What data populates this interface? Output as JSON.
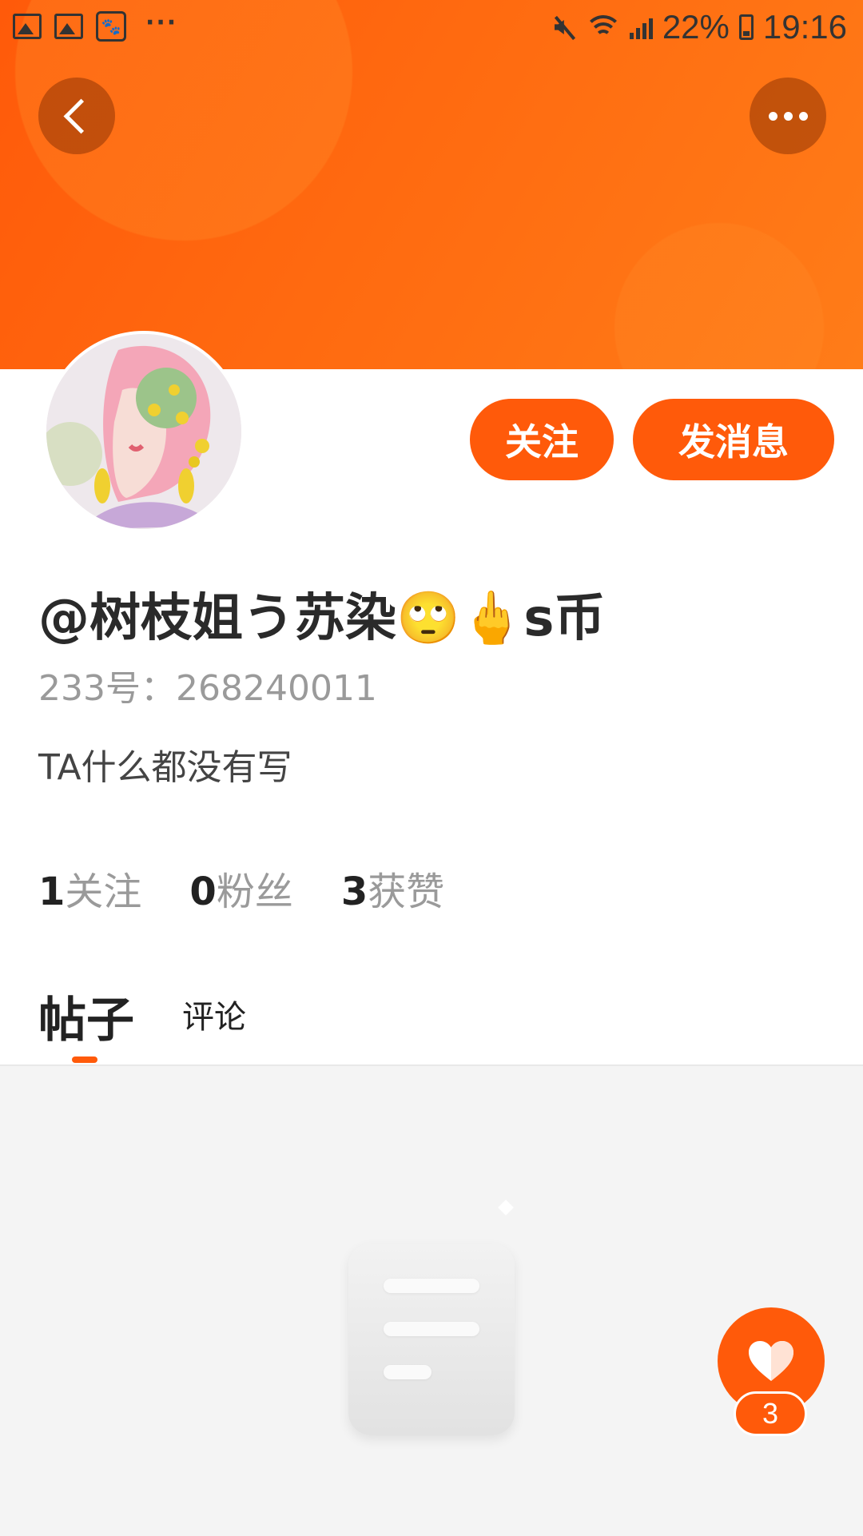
{
  "status_bar": {
    "battery": "22%",
    "time": "19:16",
    "more_glyph": "···",
    "icons": [
      "gallery-icon",
      "gallery-icon",
      "baidu-paw-icon",
      "mute-icon",
      "wifi-icon",
      "signal-icon",
      "battery-icon"
    ]
  },
  "header": {
    "back_icon": "chevron-left-icon",
    "more_icon": "more-dots-icon"
  },
  "profile": {
    "username": "@树枝姐う苏染🙄🖕s币",
    "user_id": "233号：268240011",
    "bio": "TA什么都没有写"
  },
  "actions": {
    "follow": "关注",
    "message": "发消息"
  },
  "stats": [
    {
      "value": "1",
      "label": "关注"
    },
    {
      "value": "0",
      "label": "粉丝"
    },
    {
      "value": "3",
      "label": "获赞"
    }
  ],
  "tabs": [
    {
      "label": "帖子",
      "active": true
    },
    {
      "label": "评论",
      "active": false
    }
  ],
  "like": {
    "count": "3",
    "icon": "heart-icon"
  },
  "colors": {
    "accent": "#ff5a0a",
    "header_gradient_start": "#ff5a0a",
    "header_gradient_end": "#ff7c18",
    "content_background": "#f4f4f4"
  }
}
